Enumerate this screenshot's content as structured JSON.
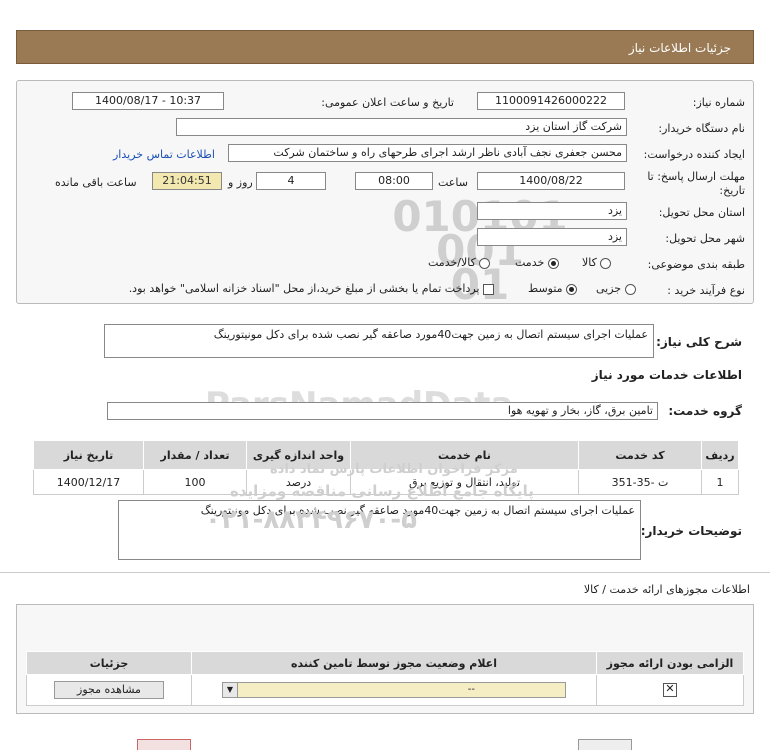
{
  "header": {
    "title": "جزئیات اطلاعات نیاز"
  },
  "form": {
    "need_number_label": "شماره نیاز:",
    "need_number": "1100091426000222",
    "announce_label": "تاریخ و ساعت اعلان عمومی:",
    "announce_value": "1400/08/17 - 10:37",
    "buyer_org_label": "نام دستگاه خریدار:",
    "buyer_org": "شرکت گاز استان یزد",
    "requester_label": "ایجاد کننده درخواست:",
    "requester": "محسن جعفری نجف آبادی ناظر ارشد اجرای طرحهای راه و ساختمان شرکت",
    "contact_link": "اطلاعات تماس خریدار",
    "deadline_label": "مهلت ارسال پاسخ: تا تاریخ:",
    "deadline_date": "1400/08/22",
    "time_label": "ساعت",
    "deadline_time": "08:00",
    "days_value": "4",
    "days_label": "روز و",
    "remaining_time": "21:04:51",
    "remaining_label": "ساعت باقی مانده",
    "province_label": "استان محل تحویل:",
    "province": "یزد",
    "city_label": "شهر محل تحویل:",
    "city": "یزد",
    "category_label": "طبقه بندی موضوعی:",
    "category_options": [
      "کالا",
      "خدمت",
      "کالا/خدمت"
    ],
    "category_selected": "خدمت",
    "process_label": "نوع فرآیند خرید :",
    "process_options": [
      "جزیی",
      "متوسط"
    ],
    "process_selected": "متوسط",
    "payment_note": "پرداخت تمام یا بخشی از مبلغ خرید،از محل \"اسناد خزانه اسلامی\" خواهد بود."
  },
  "summary": {
    "label": "شرح کلی نیاز:",
    "text": "عملیات اجرای سیستم اتصال به زمین جهت40مورد صاعقه گیر نصب شده برای دکل مونیتورینگ"
  },
  "services": {
    "title": "اطلاعات خدمات مورد نیاز",
    "group_label": "گروه خدمت:",
    "group_value": "تامین برق، گاز، بخار و تهویه هوا",
    "columns": [
      "ردیف",
      "کد خدمت",
      "نام خدمت",
      "واحد اندازه گیری",
      "تعداد / مقدار",
      "تاریخ نیاز"
    ],
    "rows": [
      [
        "1",
        "ت -35-351",
        "تولید، انتقال و توزیع برق",
        "درصد",
        "100",
        "1400/12/17"
      ]
    ]
  },
  "buyer_notes": {
    "label": "توضیحات خریدار:",
    "text": "عملیات اجرای سیستم اتصال به زمین جهت40مورد صاعقه گیر نصب شده برای دکل مونیتورینگ"
  },
  "licenses": {
    "title": "اطلاعات مجوزهای ارائه خدمت / کالا",
    "columns": [
      "الزامی بودن ارائه مجوز",
      "اعلام وضعیت مجوز توسط تامین کننده",
      "جزئیات"
    ],
    "status_value": "--",
    "view_button": "مشاهده مجوز"
  },
  "watermark": {
    "number_lines": [
      "010101",
      "001",
      "01"
    ],
    "brand": "ParsNamadData",
    "lines": [
      "مرکز فراخوان اطلاعات پارس نماد داده",
      "پایگاه جامع اطلاع رسانی مناقصه ومزایده",
      "۰۲۱-۸۸۳۴۹۶۷۰-۵"
    ]
  }
}
